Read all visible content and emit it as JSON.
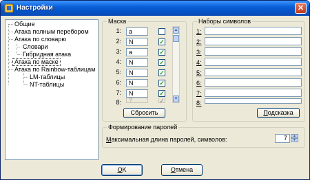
{
  "window": {
    "title": "Настройки",
    "close_glyph": "✕"
  },
  "tree": {
    "items": [
      {
        "label": "Общие"
      },
      {
        "label": "Атака полным перебором"
      },
      {
        "label": "Атака по словарю"
      },
      {
        "label": "Словари"
      },
      {
        "label": "Гибридная атака"
      },
      {
        "label": "Атака по маске",
        "selected": true
      },
      {
        "label": "Атака по Rainbow-таблицам"
      },
      {
        "label": "LM-таблицы"
      },
      {
        "label": "NT-таблицы"
      }
    ]
  },
  "mask": {
    "title": "Маска",
    "rows": [
      {
        "num": "1:",
        "value": "a",
        "checked": false
      },
      {
        "num": "2:",
        "value": "N",
        "checked": true
      },
      {
        "num": "3:",
        "value": "a",
        "checked": true
      },
      {
        "num": "4:",
        "value": "N",
        "checked": true
      },
      {
        "num": "5:",
        "value": "N",
        "checked": true
      },
      {
        "num": "6:",
        "value": "N",
        "checked": true
      },
      {
        "num": "7:",
        "value": "N",
        "checked": true
      },
      {
        "num": "8:",
        "value": "?",
        "checked": true,
        "disabled": true
      }
    ],
    "reset_label": "Сбросить"
  },
  "charsets": {
    "title": "Наборы символов",
    "rows": [
      "1:",
      "2:",
      "3:",
      "4:",
      "5:",
      "6:",
      "7:",
      "8:"
    ],
    "hint_label": "Подсказка"
  },
  "generation": {
    "title": "Формирование паролей",
    "max_length_label": "Максимальная длина паролей, символов:",
    "max_length_value": "7"
  },
  "buttons": {
    "ok": "OK",
    "cancel": "Отмена"
  },
  "icons": {
    "checkmark": "✓",
    "arrow_up": "▲",
    "arrow_down": "▼"
  }
}
